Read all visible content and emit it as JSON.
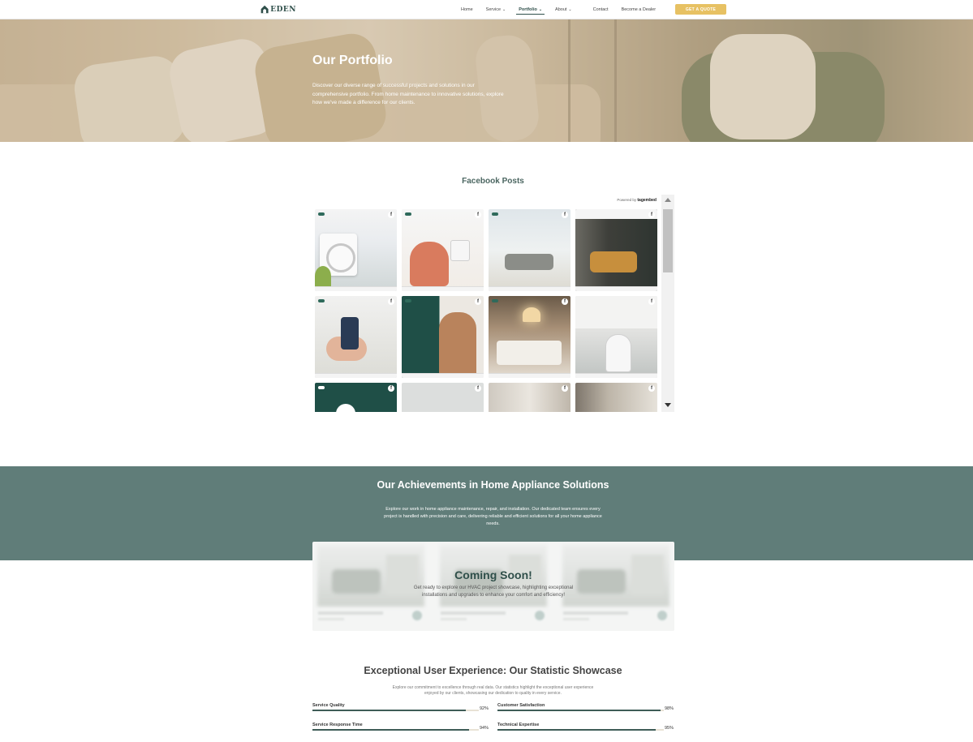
{
  "header": {
    "logo_text": "EDEN",
    "nav": [
      {
        "label": "Home",
        "has_dropdown": false,
        "active": false
      },
      {
        "label": "Service",
        "has_dropdown": true,
        "active": false
      },
      {
        "label": "Portfolio",
        "has_dropdown": true,
        "active": true
      },
      {
        "label": "About",
        "has_dropdown": true,
        "active": false
      },
      {
        "label": "Contact",
        "has_dropdown": false,
        "active": false
      },
      {
        "label": "Become a Dealer",
        "has_dropdown": false,
        "active": false
      }
    ],
    "cta_label": "GET A QUOTE",
    "cta_color": "#e7c163"
  },
  "hero": {
    "title": "Our Portfolio",
    "description": "Discover our diverse range of successful projects and solutions in our comprehensive portfolio. From home maintenance to innovative solutions, explore how we've made a difference for our clients."
  },
  "facebook": {
    "title": "Facebook Posts",
    "powered_prefix": "Powered by",
    "powered_brand": "tagembed"
  },
  "achievements": {
    "title": "Our Achievements in Home Appliance Solutions",
    "description": "Explore our work in home appliance maintenance, repair, and installation. Our dedicated team ensures every project is handled with precision and care, delivering reliable and efficient solutions for all your home appliance needs.",
    "coming_title": "Coming Soon!",
    "coming_desc": "Get ready to explore our HVAC project showcase, highlighting exceptional installations and upgrades to enhance your comfort and efficiency!",
    "band_color": "#607d79"
  },
  "stats": {
    "title": "Exceptional User Experience: Our Statistic Showcase",
    "description": "Explore our commitment to excellence through real data. Our statistics highlight the exceptional user experience enjoyed by our clients, showcasing our dedication to quality in every service.",
    "items": [
      {
        "label": "Service Quality",
        "value": 92,
        "display": "92%"
      },
      {
        "label": "Customer Satisfaction",
        "value": 98,
        "display": "98%"
      },
      {
        "label": "Service Response Time",
        "value": 94,
        "display": "94%"
      },
      {
        "label": "Technical Expertise",
        "value": 95,
        "display": "95%"
      }
    ]
  },
  "colors": {
    "brand_dark": "#2f4f4a",
    "bar_fill": "#3e5c57",
    "bar_track": "#e8e2d5"
  }
}
